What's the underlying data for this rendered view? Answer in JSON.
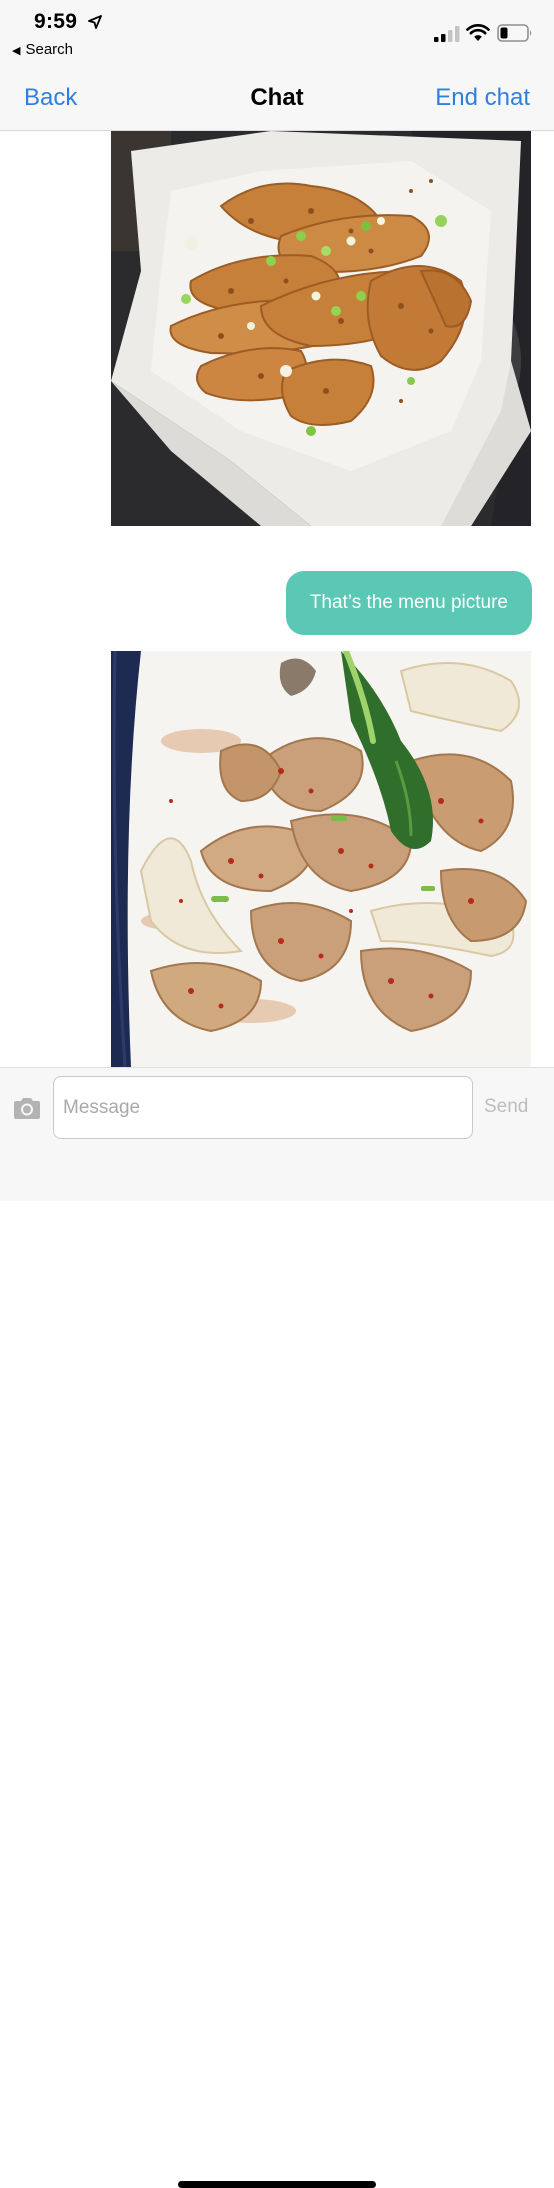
{
  "status_bar": {
    "time": "9:59",
    "back_app_label": "Search",
    "icons": [
      "location-arrow-icon",
      "signal-icon",
      "wifi-icon",
      "battery-icon"
    ]
  },
  "nav": {
    "back_label": "Back",
    "title": "Chat",
    "end_label": "End chat"
  },
  "messages": [
    {
      "type": "image",
      "subject": "fried chicken on paper liner"
    },
    {
      "type": "text",
      "text": "That’s the menu picture"
    },
    {
      "type": "image",
      "subject": "stir-fried chicken with bok choy"
    }
  ],
  "composer": {
    "placeholder": "Message",
    "send_label": "Send",
    "camera_icon": "camera-icon"
  },
  "colors": {
    "accent": "#2f7fe0",
    "bubble": "#5bc8b5",
    "send_disabled": "#bdbdbd"
  }
}
